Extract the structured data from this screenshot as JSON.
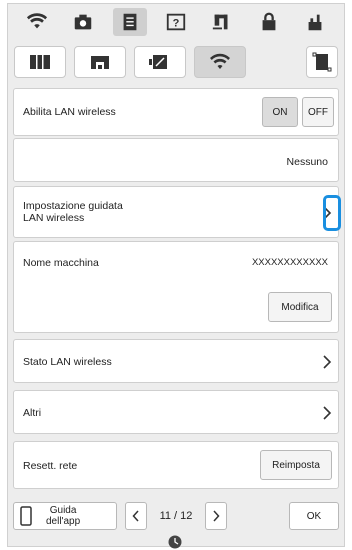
{
  "wifi_toggle": {
    "label": "Abilita LAN wireless",
    "on_label": "ON",
    "off_label": "OFF"
  },
  "network": {
    "value": "Nessuno"
  },
  "guided_setup": {
    "label_line1": "Impostazione guidata",
    "label_line2": "LAN wireless"
  },
  "machine_name": {
    "label": "Nome macchina",
    "value": "XXXXXXXXXXXX",
    "edit_label": "Modifica"
  },
  "wlan_status": {
    "label": "Stato LAN wireless"
  },
  "others": {
    "label": "Altri"
  },
  "network_reset": {
    "label": "Resett. rete",
    "reset_label": "Reimposta"
  },
  "bottom": {
    "guide_line1": "Guida",
    "guide_line2": "dell'app",
    "page": "11 / 12",
    "ok_label": "OK"
  },
  "colors": {
    "highlight": "#1a8fe0"
  }
}
